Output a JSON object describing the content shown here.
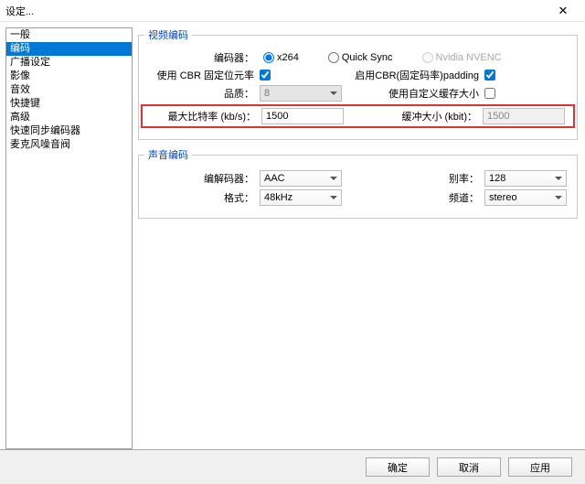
{
  "window": {
    "title": "设定...",
    "close": "✕"
  },
  "sidebar": {
    "items": [
      {
        "label": "一般"
      },
      {
        "label": "编码"
      },
      {
        "label": "广播设定"
      },
      {
        "label": "影像"
      },
      {
        "label": "音效"
      },
      {
        "label": "快捷键"
      },
      {
        "label": "高级"
      },
      {
        "label": "快速同步编码器"
      },
      {
        "label": "麦克风噪音阀"
      }
    ],
    "selected_index": 1
  },
  "video": {
    "legend": "视频编码",
    "encoder_label": "编码器：",
    "encoders": {
      "x264": "x264",
      "quicksync": "Quick Sync",
      "nvenc": "Nvidia NVENC"
    },
    "selected_encoder": "x264",
    "use_cbr_label": "使用 CBR 固定位元率",
    "use_cbr_checked": true,
    "enable_cbr_padding_label": "启用CBR(固定码率)padding",
    "enable_cbr_padding_checked": true,
    "quality_label": "品质：",
    "quality_value": "8",
    "custom_buffer_label": "使用自定义缓存大小",
    "custom_buffer_checked": false,
    "max_bitrate_label": "最大比特率 (kb/s)：",
    "max_bitrate_value": "1500",
    "buffer_size_label": "缓冲大小 (kbit)：",
    "buffer_size_value": "1500"
  },
  "audio": {
    "legend": "声音编码",
    "codec_label": "编解码器：",
    "codec_value": "AAC",
    "bitrate_label": "别率：",
    "bitrate_value": "128",
    "format_label": "格式：",
    "format_value": "48kHz",
    "channel_label": "频道：",
    "channel_value": "stereo"
  },
  "buttons": {
    "ok": "确定",
    "cancel": "取消",
    "apply": "应用"
  }
}
